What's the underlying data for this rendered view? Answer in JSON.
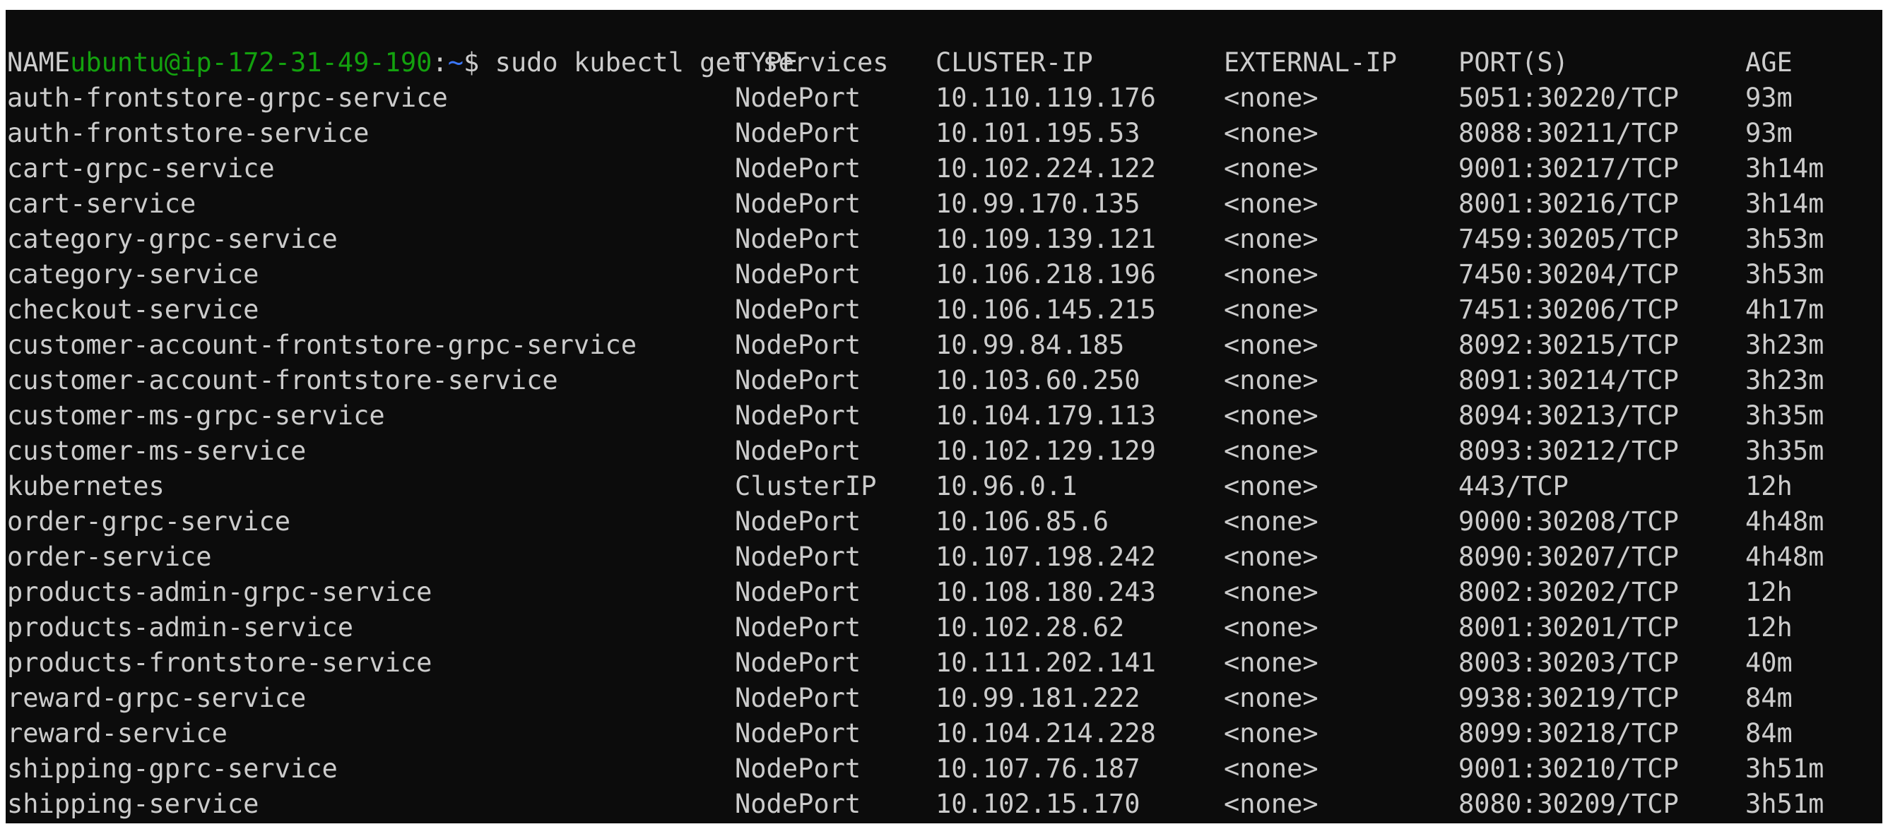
{
  "prompt": {
    "user_host": "ubuntu@ip-172-31-49-190",
    "separator": ":",
    "path": "~",
    "symbol": "$ ",
    "command": "sudo kubectl get services"
  },
  "headers": {
    "name": "NAME",
    "type": "TYPE",
    "cluster_ip": "CLUSTER-IP",
    "external_ip": "EXTERNAL-IP",
    "ports": "PORT(S)",
    "age": "AGE"
  },
  "rows": [
    {
      "name": "auth-frontstore-grpc-service",
      "type": "NodePort",
      "cluster_ip": "10.110.119.176",
      "external_ip": "<none>",
      "ports": "5051:30220/TCP",
      "age": "93m"
    },
    {
      "name": "auth-frontstore-service",
      "type": "NodePort",
      "cluster_ip": "10.101.195.53",
      "external_ip": "<none>",
      "ports": "8088:30211/TCP",
      "age": "93m"
    },
    {
      "name": "cart-grpc-service",
      "type": "NodePort",
      "cluster_ip": "10.102.224.122",
      "external_ip": "<none>",
      "ports": "9001:30217/TCP",
      "age": "3h14m"
    },
    {
      "name": "cart-service",
      "type": "NodePort",
      "cluster_ip": "10.99.170.135",
      "external_ip": "<none>",
      "ports": "8001:30216/TCP",
      "age": "3h14m"
    },
    {
      "name": "category-grpc-service",
      "type": "NodePort",
      "cluster_ip": "10.109.139.121",
      "external_ip": "<none>",
      "ports": "7459:30205/TCP",
      "age": "3h53m"
    },
    {
      "name": "category-service",
      "type": "NodePort",
      "cluster_ip": "10.106.218.196",
      "external_ip": "<none>",
      "ports": "7450:30204/TCP",
      "age": "3h53m"
    },
    {
      "name": "checkout-service",
      "type": "NodePort",
      "cluster_ip": "10.106.145.215",
      "external_ip": "<none>",
      "ports": "7451:30206/TCP",
      "age": "4h17m"
    },
    {
      "name": "customer-account-frontstore-grpc-service",
      "type": "NodePort",
      "cluster_ip": "10.99.84.185",
      "external_ip": "<none>",
      "ports": "8092:30215/TCP",
      "age": "3h23m"
    },
    {
      "name": "customer-account-frontstore-service",
      "type": "NodePort",
      "cluster_ip": "10.103.60.250",
      "external_ip": "<none>",
      "ports": "8091:30214/TCP",
      "age": "3h23m"
    },
    {
      "name": "customer-ms-grpc-service",
      "type": "NodePort",
      "cluster_ip": "10.104.179.113",
      "external_ip": "<none>",
      "ports": "8094:30213/TCP",
      "age": "3h35m"
    },
    {
      "name": "customer-ms-service",
      "type": "NodePort",
      "cluster_ip": "10.102.129.129",
      "external_ip": "<none>",
      "ports": "8093:30212/TCP",
      "age": "3h35m"
    },
    {
      "name": "kubernetes",
      "type": "ClusterIP",
      "cluster_ip": "10.96.0.1",
      "external_ip": "<none>",
      "ports": "443/TCP",
      "age": "12h"
    },
    {
      "name": "order-grpc-service",
      "type": "NodePort",
      "cluster_ip": "10.106.85.6",
      "external_ip": "<none>",
      "ports": "9000:30208/TCP",
      "age": "4h48m"
    },
    {
      "name": "order-service",
      "type": "NodePort",
      "cluster_ip": "10.107.198.242",
      "external_ip": "<none>",
      "ports": "8090:30207/TCP",
      "age": "4h48m"
    },
    {
      "name": "products-admin-grpc-service",
      "type": "NodePort",
      "cluster_ip": "10.108.180.243",
      "external_ip": "<none>",
      "ports": "8002:30202/TCP",
      "age": "12h"
    },
    {
      "name": "products-admin-service",
      "type": "NodePort",
      "cluster_ip": "10.102.28.62",
      "external_ip": "<none>",
      "ports": "8001:30201/TCP",
      "age": "12h"
    },
    {
      "name": "products-frontstore-service",
      "type": "NodePort",
      "cluster_ip": "10.111.202.141",
      "external_ip": "<none>",
      "ports": "8003:30203/TCP",
      "age": "40m"
    },
    {
      "name": "reward-grpc-service",
      "type": "NodePort",
      "cluster_ip": "10.99.181.222",
      "external_ip": "<none>",
      "ports": "9938:30219/TCP",
      "age": "84m"
    },
    {
      "name": "reward-service",
      "type": "NodePort",
      "cluster_ip": "10.104.214.228",
      "external_ip": "<none>",
      "ports": "8099:30218/TCP",
      "age": "84m"
    },
    {
      "name": "shipping-gprc-service",
      "type": "NodePort",
      "cluster_ip": "10.107.76.187",
      "external_ip": "<none>",
      "ports": "9001:30210/TCP",
      "age": "3h51m"
    },
    {
      "name": "shipping-service",
      "type": "NodePort",
      "cluster_ip": "10.102.15.170",
      "external_ip": "<none>",
      "ports": "8080:30209/TCP",
      "age": "3h51m"
    }
  ],
  "colors": {
    "background": "#0c0c0c",
    "foreground": "#cccccc",
    "prompt_user": "#13a10e",
    "prompt_path": "#3b78ff"
  }
}
